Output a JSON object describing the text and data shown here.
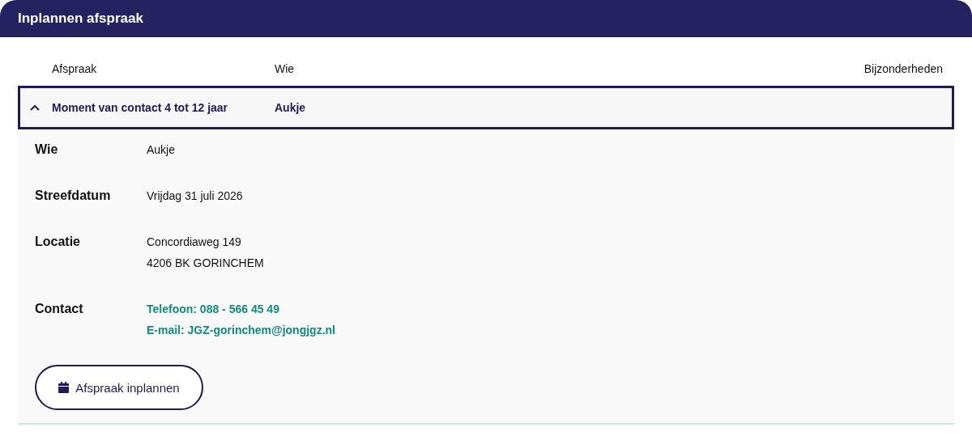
{
  "header": {
    "title": "Inplannen afspraak"
  },
  "table": {
    "columns": [
      "Afspraak",
      "Wie",
      "Bijzonderheden"
    ],
    "rows": [
      {
        "afspraak": "Moment van contact 4 tot 12 jaar",
        "wie": "Aukje",
        "expanded": true,
        "details": [
          {
            "kind": "text",
            "label": "Wie",
            "lines": [
              "Aukje"
            ]
          },
          {
            "kind": "text",
            "label": "Streefdatum",
            "lines": [
              "Vrijdag 31 juli 2026"
            ]
          },
          {
            "kind": "text",
            "label": "Locatie",
            "lines": [
              "Concordiaweg 149",
              "4206 BK GORINCHEM"
            ]
          },
          {
            "kind": "link",
            "label": "Contact",
            "lines": [
              "Telefoon: 088 - 566 45 49",
              "E-mail: JGZ-gorinchem@jongjgz.nl"
            ]
          }
        ],
        "action": {
          "label": "Afspraak inplannen"
        }
      }
    ]
  }
}
